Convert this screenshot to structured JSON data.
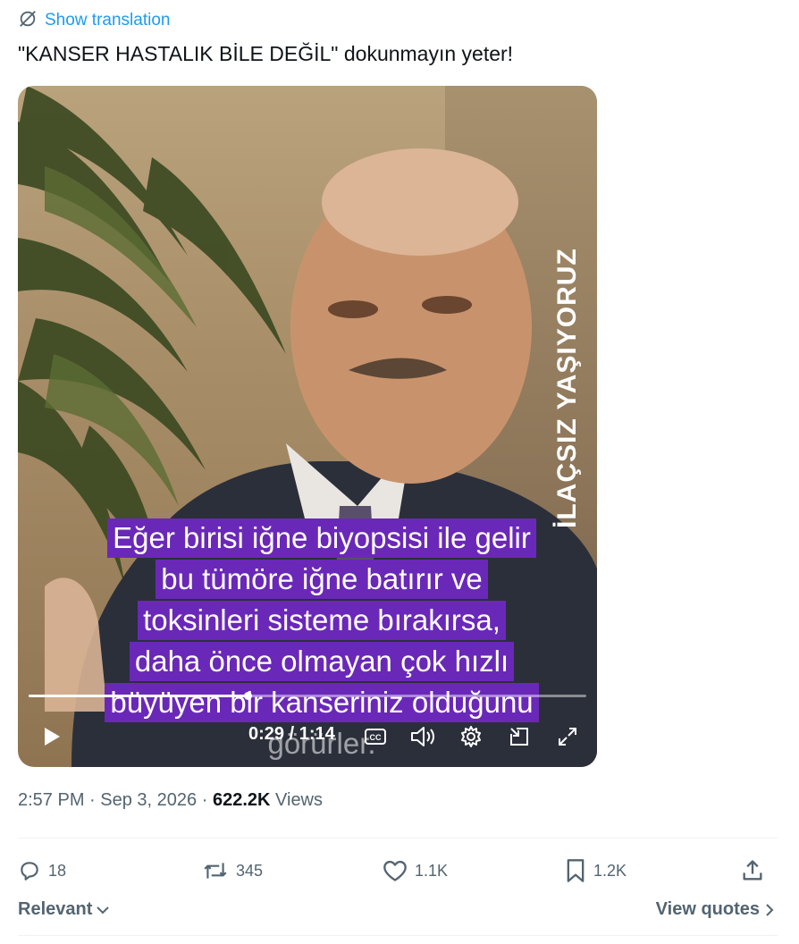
{
  "tweet": {
    "show_translation": "Show translation",
    "text": "\"KANSER HASTALIK BİLE DEĞİL\" dokunmayın yeter!"
  },
  "video": {
    "watermark": "İLAÇSIZ YAŞIYORUZ",
    "subtitles": [
      "Eğer birisi iğne biyopsisi ile gelir",
      "bu tümöre iğne batırır ve",
      "toksinleri sisteme bırakırsa,",
      "daha önce olmayan çok hızlı",
      "büyüyen bir kanseriniz olduğunu",
      "görürler."
    ],
    "time_display": "0:29 / 1:14",
    "progress": 0.392,
    "icons": {
      "play": "play-icon",
      "captions": "captions-icon",
      "volume": "volume-icon",
      "settings": "gear-icon",
      "pip": "picture-in-picture-icon",
      "fullscreen": "fullscreen-icon"
    }
  },
  "meta": {
    "time": "2:57 PM",
    "separator": "·",
    "date": "Sep 3, 2026",
    "views_count": "622.2K",
    "views_label": "Views"
  },
  "actions": {
    "replies": "18",
    "retweets": "345",
    "likes": "1.1K",
    "bookmarks": "1.2K"
  },
  "footer": {
    "sort_label": "Relevant",
    "view_quotes": "View quotes"
  },
  "colors": {
    "accent": "#1d9bf0",
    "subtitle_bg": "#6a28b8",
    "muted_text": "#536471"
  }
}
